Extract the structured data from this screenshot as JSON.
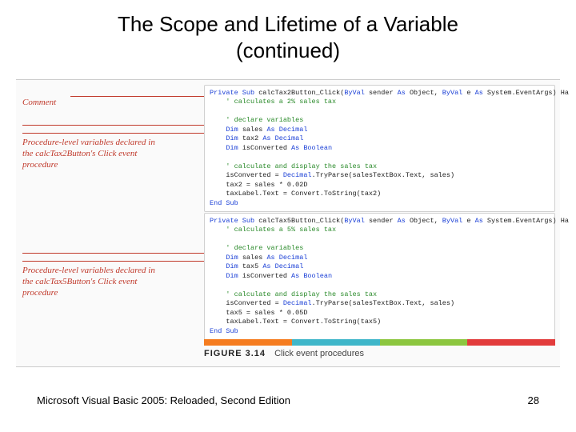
{
  "title_line1": "The Scope and Lifetime of a Variable",
  "title_line2": "(continued)",
  "annotations": {
    "comment": "Comment",
    "proc2": "Procedure-level variables declared in the calcTax2Button's Click event procedure",
    "proc5": "Procedure-level variables declared in the calcTax5Button's Click event procedure"
  },
  "code": {
    "block1": {
      "l1a": "Private Sub",
      "l1b": " calcTax2Button_Click(",
      "l1c": "ByVal",
      "l1d": " sender ",
      "l1e": "As",
      "l1f": " Object, ",
      "l1g": "ByVal",
      "l1h": " e ",
      "l1i": "As",
      "l1j": " System.EventArgs) Ha",
      "l2": "    ' calculates a 2% sales tax",
      "l4": "    ' declare variables",
      "l5a": "    Dim",
      "l5b": " sales ",
      "l5c": "As Decimal",
      "l6a": "    Dim",
      "l6b": " tax2 ",
      "l6c": "As Decimal",
      "l7a": "    Dim",
      "l7b": " isConverted ",
      "l7c": "As Boolean",
      "l9": "    ' calculate and display the sales tax",
      "l10a": "    isConverted = ",
      "l10b": "Decimal",
      "l10c": ".TryParse(salesTextBox.Text, sales)",
      "l11": "    tax2 = sales * 0.02D",
      "l12": "    taxLabel.Text = Convert.ToString(tax2)",
      "l13": "End Sub"
    },
    "block2": {
      "l1a": "Private Sub",
      "l1b": " calcTax5Button_Click(",
      "l1c": "ByVal",
      "l1d": " sender ",
      "l1e": "As",
      "l1f": " Object, ",
      "l1g": "ByVal",
      "l1h": " e ",
      "l1i": "As",
      "l1j": " System.EventArgs) Ha",
      "l2": "    ' calculates a 5% sales tax",
      "l4": "    ' declare variables",
      "l5a": "    Dim",
      "l5b": " sales ",
      "l5c": "As Decimal",
      "l6a": "    Dim",
      "l6b": " tax5 ",
      "l6c": "As Decimal",
      "l7a": "    Dim",
      "l7b": " isConverted ",
      "l7c": "As Boolean",
      "l9": "    ' calculate and display the sales tax",
      "l10a": "    isConverted = ",
      "l10b": "Decimal",
      "l10c": ".TryParse(salesTextBox.Text, sales)",
      "l11": "    tax5 = sales * 0.05D",
      "l12": "    taxLabel.Text = Convert.ToString(tax5)",
      "l13": "End Sub"
    }
  },
  "figure": {
    "label": "FIGURE 3.14",
    "caption": "Click event procedures"
  },
  "stripe_colors": [
    "#f57c1f",
    "#3fb6c9",
    "#8cc63f",
    "#e23b3b"
  ],
  "footer": {
    "left": "Microsoft Visual Basic 2005: Reloaded, Second Edition",
    "right": "28"
  }
}
